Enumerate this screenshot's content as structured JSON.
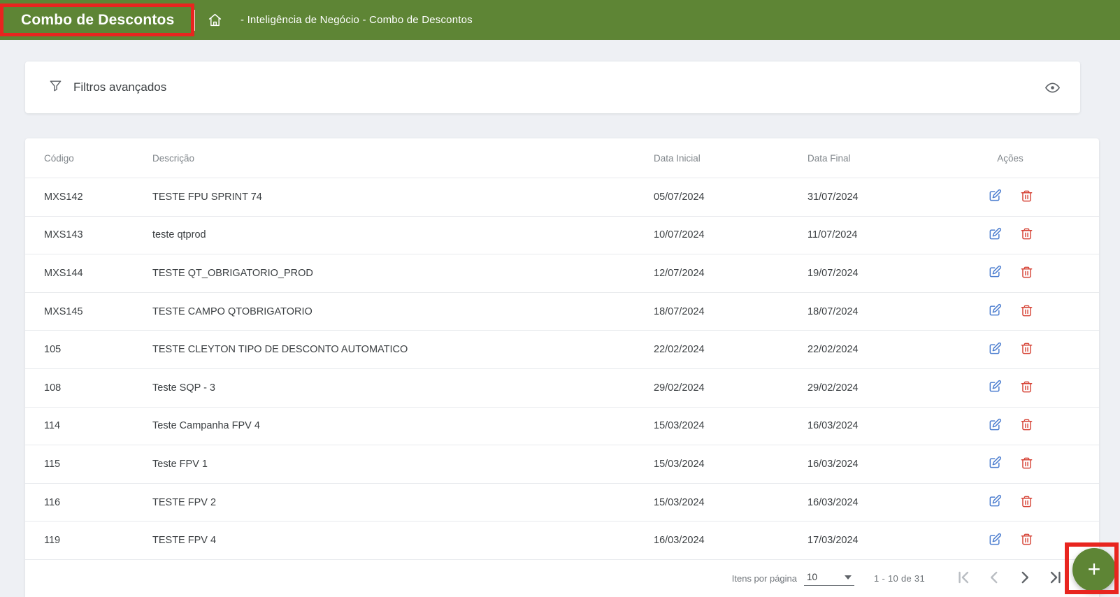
{
  "header": {
    "title": "Combo de Descontos",
    "breadcrumb": "- Inteligência de Negócio - Combo de Descontos",
    "bg_color": "#5e8535"
  },
  "annotations": {
    "highlight_color": "#e8251f",
    "highlighted_elements": [
      "page-title",
      "add-button"
    ]
  },
  "filters": {
    "label": "Filtros avançados",
    "icons": [
      "filter-funnel-icon",
      "eye-icon"
    ]
  },
  "table": {
    "columns": [
      "Código",
      "Descrição",
      "Data Inicial",
      "Data Final",
      "Ações"
    ],
    "action_icons": [
      "edit-icon",
      "delete-icon"
    ],
    "action_colors": {
      "edit": "#4e7fd0",
      "delete": "#d64437"
    },
    "rows": [
      {
        "codigo": "MXS142",
        "descricao": "TESTE FPU SPRINT 74",
        "data_inicial": "05/07/2024",
        "data_final": "31/07/2024"
      },
      {
        "codigo": "MXS143",
        "descricao": "teste qtprod",
        "data_inicial": "10/07/2024",
        "data_final": "11/07/2024"
      },
      {
        "codigo": "MXS144",
        "descricao": "TESTE QT_OBRIGATORIO_PROD",
        "data_inicial": "12/07/2024",
        "data_final": "19/07/2024"
      },
      {
        "codigo": "MXS145",
        "descricao": "TESTE CAMPO QTOBRIGATORIO",
        "data_inicial": "18/07/2024",
        "data_final": "18/07/2024"
      },
      {
        "codigo": "105",
        "descricao": "TESTE CLEYTON TIPO DE DESCONTO AUTOMATICO",
        "data_inicial": "22/02/2024",
        "data_final": "22/02/2024"
      },
      {
        "codigo": "108",
        "descricao": "Teste SQP - 3",
        "data_inicial": "29/02/2024",
        "data_final": "29/02/2024"
      },
      {
        "codigo": "114",
        "descricao": "Teste Campanha FPV 4",
        "data_inicial": "15/03/2024",
        "data_final": "16/03/2024"
      },
      {
        "codigo": "115",
        "descricao": "Teste FPV 1",
        "data_inicial": "15/03/2024",
        "data_final": "16/03/2024"
      },
      {
        "codigo": "116",
        "descricao": "TESTE FPV 2",
        "data_inicial": "15/03/2024",
        "data_final": "16/03/2024"
      },
      {
        "codigo": "119",
        "descricao": "TESTE FPV 4",
        "data_inicial": "16/03/2024",
        "data_final": "17/03/2024"
      }
    ]
  },
  "pagination": {
    "items_per_page_label": "Itens por página",
    "items_per_page_value": "10",
    "range_label": "1 - 10 de 31",
    "nav_icons": [
      "first-page-icon",
      "previous-page-icon",
      "next-page-icon",
      "last-page-icon"
    ]
  },
  "fab": {
    "label": "+"
  }
}
